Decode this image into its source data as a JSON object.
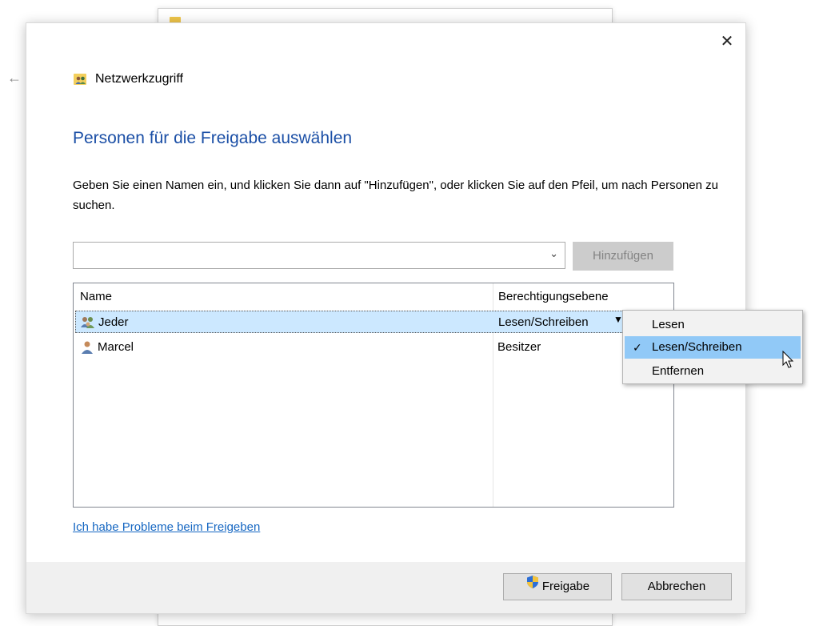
{
  "background_window": {
    "title": ""
  },
  "dialog": {
    "close_symbol": "✕",
    "back_symbol": "←",
    "network_label": "Netzwerkzugriff",
    "heading": "Personen für die Freigabe auswählen",
    "instruction": "Geben Sie einen Namen ein, und klicken Sie dann auf \"Hinzufügen\", oder klicken Sie auf den Pfeil, um nach Personen zu suchen.",
    "combo": {
      "value": "",
      "arrow": "⌄"
    },
    "add_button": {
      "label": "Hinzufügen",
      "mnemonic_prefix": "",
      "state": "disabled"
    },
    "list": {
      "columns": {
        "name": "Name",
        "permission": "Berechtigungsebene"
      },
      "rows": [
        {
          "name": "Jeder",
          "permission": "Lesen/Schreiben",
          "icon": "users-group-icon",
          "selected": true
        },
        {
          "name": "Marcel",
          "permission": "Besitzer",
          "icon": "user-icon",
          "selected": false
        }
      ]
    },
    "permission_menu": {
      "items": [
        {
          "label": "Lesen",
          "checked": false
        },
        {
          "label": "Lesen/Schreiben",
          "checked": true
        },
        {
          "label": "Entfernen",
          "checked": false
        }
      ],
      "check_symbol": "✓"
    },
    "help_link": "Ich habe Probleme beim Freigeben",
    "footer": {
      "share_button": "Freigabe",
      "cancel_button": "Abbrechen"
    }
  },
  "colors": {
    "heading": "#1b4fa6",
    "link": "#1667c2",
    "selection": "#cce8ff",
    "menu_hover": "#91c9f7"
  }
}
